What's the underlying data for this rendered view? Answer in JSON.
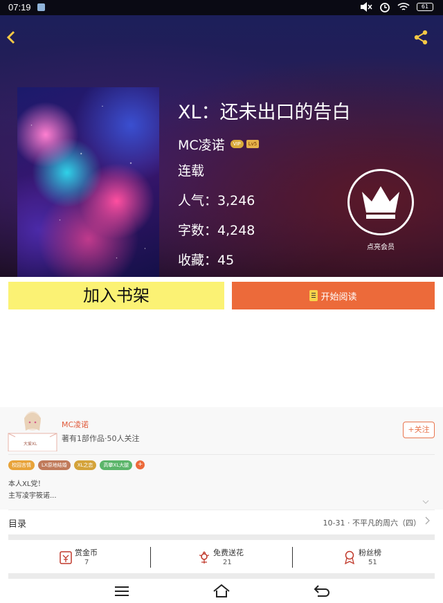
{
  "status_bar": {
    "time": "07:19",
    "battery": "61"
  },
  "book": {
    "title": "XL：还未出口的告白",
    "author": "MC凌诺",
    "vip_badge": "VIP",
    "level_badge": "Lv5",
    "status": "连载",
    "popularity": "人气：3,246",
    "word_count": "字数：4,248",
    "favorites": "收藏：45"
  },
  "membership": {
    "label": "点亮会员"
  },
  "actions": {
    "add_shelf": "加入书架",
    "start_reading": "开始阅读"
  },
  "author_card": {
    "name": "MC凌诺",
    "meta": "著有1部作品·50人关注",
    "follow": "+关注",
    "avatar_caption": "大爱XL",
    "tags": [
      {
        "label": "校园言情",
        "color": "#e8a33a"
      },
      {
        "label": "LX原地结婚",
        "color": "#c07a5a"
      },
      {
        "label": "XL之恋",
        "color": "#d4a33a"
      },
      {
        "label": "高攀XL大腿",
        "color": "#5bb56a"
      }
    ],
    "tag_more": "+",
    "bio_line1": "本人XL党！",
    "bio_line2": "主写凌宇筱诺..."
  },
  "toc": {
    "label": "目录",
    "latest": "10-31 · 不平凡的周六（四）"
  },
  "stats": {
    "reward": {
      "label": "赏金币",
      "value": "7"
    },
    "flowers": {
      "label": "免费送花",
      "value": "21"
    },
    "fans": {
      "label": "粉丝榜",
      "value": "51"
    }
  }
}
